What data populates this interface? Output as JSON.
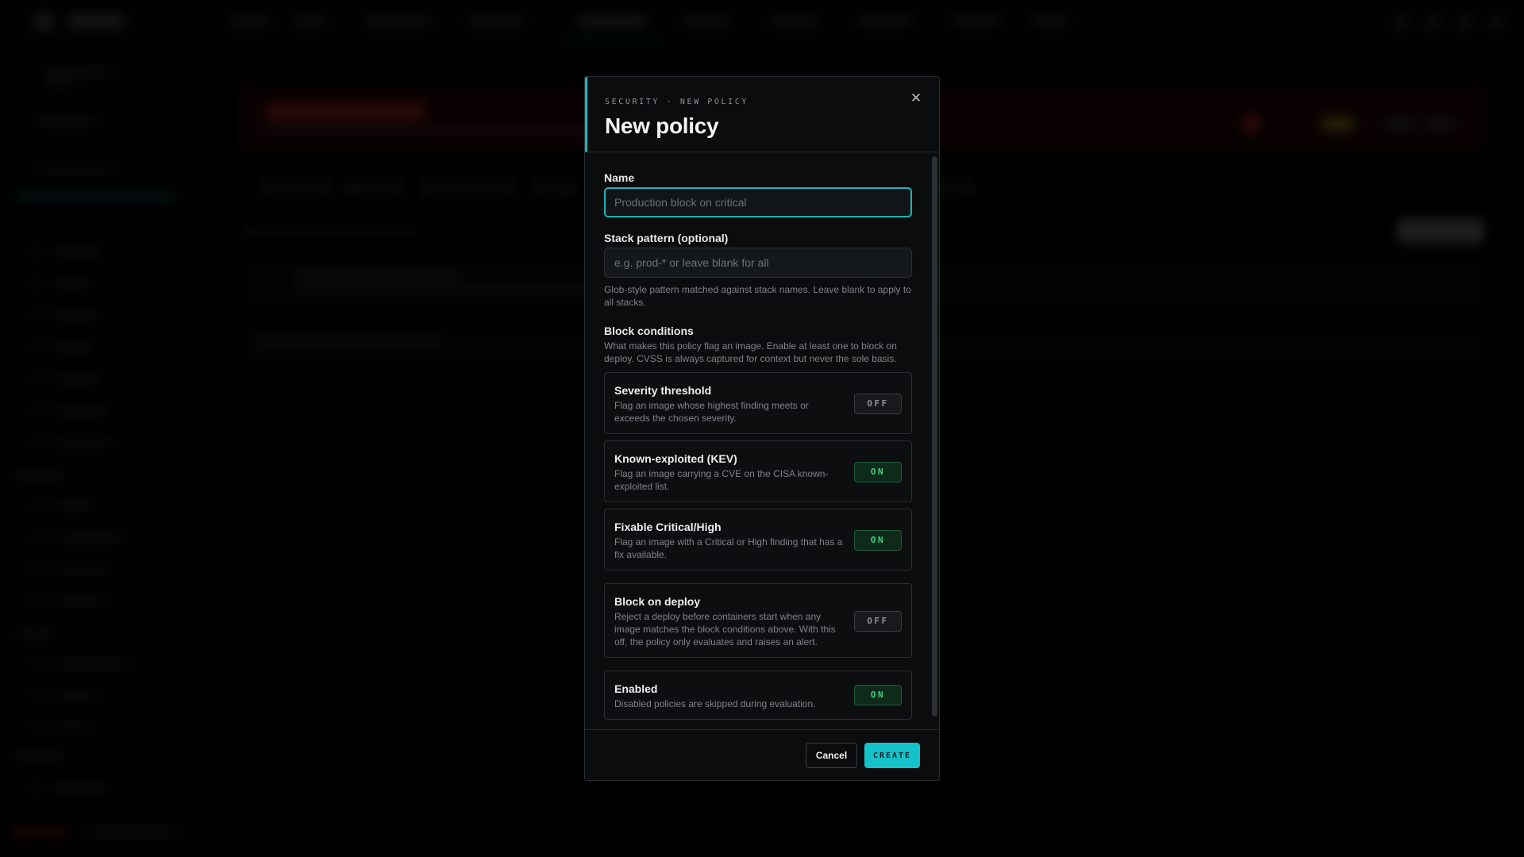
{
  "modal": {
    "eyebrow": "SECURITY · NEW POLICY",
    "title": "New policy",
    "close_glyph": "✕",
    "close_icon": "close-icon"
  },
  "form": {
    "name": {
      "label": "Name",
      "placeholder": "Production block on critical",
      "value": ""
    },
    "stack_pattern": {
      "label": "Stack pattern (optional)",
      "placeholder": "e.g. prod-* or leave blank for all",
      "value": "",
      "help": "Glob-style pattern matched against stack names. Leave blank to apply to all stacks."
    },
    "block_conditions": {
      "label": "Block conditions",
      "help": "What makes this policy flag an image. Enable at least one to block on deploy. CVSS is always captured for context but never the sole basis."
    },
    "conditions": [
      {
        "title": "Severity threshold",
        "desc": "Flag an image whose highest finding meets or exceeds the chosen severity.",
        "state": "OFF",
        "on": false
      },
      {
        "title": "Known-exploited (KEV)",
        "desc": "Flag an image carrying a CVE on the CISA known-exploited list.",
        "state": "ON",
        "on": true
      },
      {
        "title": "Fixable Critical/High",
        "desc": "Flag an image with a Critical or High finding that has a fix available.",
        "state": "ON",
        "on": true
      },
      {
        "title": "Block on deploy",
        "desc": "Reject a deploy before containers start when any image matches the block conditions above. With this off, the policy only evaluates and raises an alert.",
        "state": "OFF",
        "on": false
      },
      {
        "title": "Enabled",
        "desc": "Disabled policies are skipped during evaluation.",
        "state": "ON",
        "on": true
      }
    ]
  },
  "footer": {
    "cancel_label": "Cancel",
    "create_label": "CREATE"
  },
  "colors": {
    "accent": "#16c2c9",
    "toggle_on_text": "#3fd387",
    "toggle_on_bg": "#0d2a1a",
    "danger_bg": "#7a1818"
  }
}
